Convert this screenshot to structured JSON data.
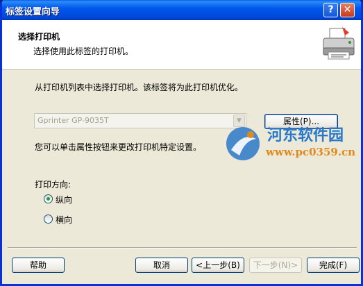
{
  "window": {
    "title": "标签设置向导",
    "help_glyph": "?",
    "close_glyph": "✕"
  },
  "header": {
    "title": "选择打印机",
    "subtitle": "选择使用此标签的打印机。"
  },
  "main": {
    "instruction": "从打印机列表中选择打印机。该标签将为此打印机优化。",
    "printer_select": {
      "value": "Gprinter GP-9035T"
    },
    "properties_button": "属性(P)...",
    "properties_hint": "您可以单击属性按钮来更改打印机特定设置。",
    "orientation": {
      "label": "打印方向:",
      "options": [
        {
          "label": "纵向",
          "checked": true
        },
        {
          "label": "横向",
          "checked": false
        }
      ]
    }
  },
  "footer": {
    "help": "帮助",
    "cancel": "取消",
    "back": "<上一步(B)",
    "next": "下一步(N)>",
    "finish": "完成(F)"
  },
  "watermark": {
    "name": "河东软件园",
    "url": "www.pc0359.cn"
  }
}
